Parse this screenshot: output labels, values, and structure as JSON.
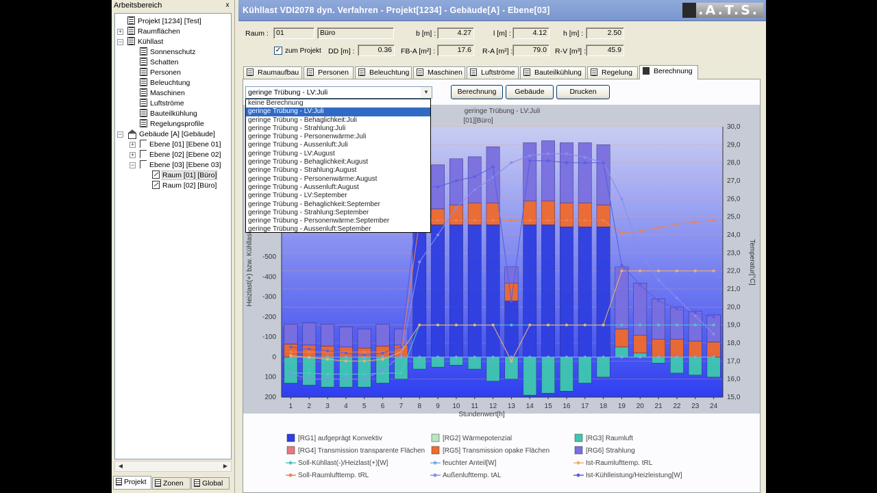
{
  "workspace": {
    "title": "Arbeitsbereich",
    "close": "x",
    "tree": [
      {
        "label": "Projekt [1234] [Test]",
        "level": 0,
        "icon": "document-icon",
        "exp": ""
      },
      {
        "label": "Raumflächen",
        "level": 0,
        "icon": "document-icon",
        "exp": "+"
      },
      {
        "label": "Kühllast",
        "level": 0,
        "icon": "document-icon",
        "exp": "-"
      },
      {
        "label": "Sonnenschutz",
        "level": 1,
        "icon": "document-icon",
        "exp": ""
      },
      {
        "label": "Schatten",
        "level": 1,
        "icon": "document-icon",
        "exp": ""
      },
      {
        "label": "Personen",
        "level": 1,
        "icon": "document-icon",
        "exp": ""
      },
      {
        "label": "Beleuchtung",
        "level": 1,
        "icon": "document-icon",
        "exp": ""
      },
      {
        "label": "Maschinen",
        "level": 1,
        "icon": "document-icon",
        "exp": ""
      },
      {
        "label": "Luftströme",
        "level": 1,
        "icon": "document-icon",
        "exp": ""
      },
      {
        "label": "Bauteilkühlung",
        "level": 1,
        "icon": "document-icon",
        "exp": ""
      },
      {
        "label": "Regelungsprofile",
        "level": 1,
        "icon": "document-icon",
        "exp": ""
      },
      {
        "label": "Gebäude [A] [Gebäude]",
        "level": 0,
        "icon": "building-icon",
        "exp": "-"
      },
      {
        "label": "Ebene [01] [Ebene 01]",
        "level": 1,
        "icon": "level-icon",
        "exp": "+"
      },
      {
        "label": "Ebene [02] [Ebene 02]",
        "level": 1,
        "icon": "level-icon",
        "exp": "+"
      },
      {
        "label": "Ebene [03] [Ebene 03]",
        "level": 1,
        "icon": "level-icon",
        "exp": "-"
      },
      {
        "label": "Raum [01] [Büro]",
        "level": 2,
        "icon": "room-icon",
        "exp": "",
        "selected": true
      },
      {
        "label": "Raum [02] [Büro]",
        "level": 2,
        "icon": "room-icon",
        "exp": ""
      }
    ],
    "tabs": [
      "Projekt",
      "Zonen",
      "Global"
    ]
  },
  "window": {
    "title": "Kühllast VDI2078 dyn. Verfahren - Projekt[1234] - Gebäude[A] - Ebene[03]",
    "logo": "C.A.T.S."
  },
  "room": {
    "raum_label": "Raum :",
    "raum_no": "01",
    "raum_name": "Büro",
    "b_label": "b [m] :",
    "b": "4.27",
    "l_label": "l [m] :",
    "l": "4.12",
    "h_label": "h [m] :",
    "h": "2.50",
    "zum_projekt": "zum Projekt",
    "zum_projekt_check": "✓",
    "dd_label": "DD [m] :",
    "dd": "0.36",
    "fba_label": "FB-A [m²] :",
    "fba": "17.6",
    "ra_label": "R-A [m²] :",
    "ra": "79.0",
    "rv_label": "R-V [m³] :",
    "rv": "45.9"
  },
  "tabs": [
    "Raumaufbau",
    "Personen",
    "Beleuchtung",
    "Maschinen",
    "Luftströme",
    "Bauteilkühlung",
    "Regelung",
    "Berechnung"
  ],
  "calc": {
    "selected": "geringe Trübung - LV:Juli",
    "buttons": [
      "Berechnung",
      "Gebäude",
      "Drucken"
    ],
    "options": [
      "keine Berechnung",
      "geringe Trübung - LV:Juli",
      "geringe Trübung - Behaglichkeit:Juli",
      "geringe Trübung - Strahlung:Juli",
      "geringe Trübung - Personenwärme:Juli",
      "geringe Trübung - Aussenluft:Juli",
      "geringe Trübung - LV:August",
      "geringe Trübung - Behaglichkeit:August",
      "geringe Trübung - Strahlung:August",
      "geringe Trübung - Personenwärme:August",
      "geringe Trübung - Aussenluft:August",
      "geringe Trübung - LV:September",
      "geringe Trübung - Behaglichkeit:September",
      "geringe Trübung - Strahlung:September",
      "geringe Trübung - Personenwärme:September",
      "geringe Trübung - Aussenluft:September"
    ],
    "selected_index": 1
  },
  "chart_data": {
    "type": "bar",
    "title": "geringe Trübung - LV:Juli",
    "subtitle": "[01][Büro]",
    "xlabel": "Stundenwert[h]",
    "ylabel": "Heizlast(+) bzw. Kühllast",
    "y2label": "Temperatur[°C]",
    "categories": [
      "1",
      "2",
      "3",
      "4",
      "5",
      "6",
      "7",
      "8",
      "9",
      "10",
      "11",
      "12",
      "13",
      "14",
      "15",
      "16",
      "17",
      "18",
      "19",
      "20",
      "21",
      "22",
      "23",
      "24"
    ],
    "ylim_inverted": [
      200,
      -1150
    ],
    "yticks": [
      200,
      100,
      0,
      -100,
      -200,
      -300,
      -400,
      -500
    ],
    "yticks_labels": [
      "200",
      "100",
      "0",
      "-100",
      "-200",
      "-300",
      "-400",
      "-500"
    ],
    "y2lim": [
      15.0,
      30.0
    ],
    "y2ticks": [
      "15,0",
      "16,0",
      "17,0",
      "18,0",
      "19,0",
      "20,0",
      "21,0",
      "22,0",
      "23,0",
      "24,0",
      "25,0",
      "26,0",
      "27,0",
      "28,0",
      "29,0",
      "30,0"
    ],
    "series": [
      {
        "name": "[RG1] aufgeprägt Konvektiv",
        "color": "#2f3fe0",
        "values": [
          0,
          0,
          0,
          0,
          0,
          0,
          0,
          -660,
          -660,
          -660,
          -660,
          -660,
          -280,
          -660,
          -660,
          -650,
          -650,
          -650,
          0,
          0,
          0,
          0,
          0,
          0
        ]
      },
      {
        "name": "[RG2] Wärmepotenzial",
        "color": "#b8e6c4",
        "values": [
          0,
          0,
          0,
          0,
          0,
          0,
          0,
          0,
          0,
          0,
          0,
          0,
          0,
          0,
          0,
          0,
          0,
          0,
          0,
          0,
          0,
          0,
          0,
          0
        ]
      },
      {
        "name": "[RG3] Raumluft",
        "color": "#3fc7b0",
        "values": [
          130,
          140,
          150,
          150,
          150,
          130,
          110,
          60,
          50,
          40,
          60,
          120,
          110,
          190,
          180,
          170,
          130,
          100,
          -50,
          -20,
          30,
          80,
          90,
          100
        ]
      },
      {
        "name": "[RG4] Transmission transparente Flächen",
        "color": "#e77880",
        "values": [
          0,
          0,
          0,
          0,
          0,
          0,
          0,
          0,
          0,
          0,
          0,
          0,
          0,
          0,
          0,
          0,
          0,
          0,
          0,
          0,
          0,
          0,
          0,
          0
        ]
      },
      {
        "name": "[RG5] Transmission opake Flächen",
        "color": "#ef6a2e",
        "values": [
          -65,
          -60,
          -55,
          -50,
          -45,
          -55,
          -60,
          -70,
          -80,
          -100,
          -110,
          -110,
          -90,
          -120,
          -120,
          -120,
          -120,
          -110,
          -90,
          -90,
          -90,
          -90,
          -80,
          -75
        ]
      },
      {
        "name": "[RG6] Strahlung",
        "color": "#7a6fe0",
        "values": [
          -100,
          -110,
          -110,
          -100,
          -95,
          -110,
          -80,
          -200,
          -220,
          -230,
          -230,
          -280,
          -80,
          -290,
          -300,
          -300,
          -300,
          -300,
          -310,
          -260,
          -200,
          -160,
          -150,
          -135
        ]
      }
    ],
    "lines": [
      {
        "name": "Soll-Kühllast(-)/Heizlast(+)[W]",
        "color": "#4fc6c6",
        "values": [
          80,
          80,
          85,
          85,
          85,
          80,
          80,
          -160,
          -160,
          -160,
          -160,
          -160,
          -160,
          -160,
          -160,
          -160,
          -160,
          -160,
          -160,
          -160,
          -160,
          -160,
          -160,
          -160
        ]
      },
      {
        "name": "feuchter Anteil[W]",
        "color": "#74b0e8",
        "values": [
          0,
          0,
          0,
          0,
          0,
          0,
          0,
          0,
          0,
          0,
          0,
          0,
          0,
          0,
          0,
          0,
          0,
          0,
          0,
          0,
          0,
          0,
          0,
          0
        ]
      },
      {
        "name": "Ist-Raumlufttemp. tRL",
        "color": "#f0b070",
        "values": [
          17.3,
          17.2,
          17.1,
          17.0,
          17.0,
          17.1,
          17.5,
          19.0,
          19.0,
          19.0,
          19.0,
          19.0,
          17.0,
          19.0,
          19.0,
          19.0,
          19.0,
          19.0,
          22.0,
          22.0,
          22.0,
          22.0,
          22.0,
          22.0
        ]
      },
      {
        "name": "Soll-Raumlufttemp. tRL",
        "color": "#f08050",
        "values": [
          17.5,
          17.5,
          17.5,
          17.5,
          17.5,
          17.5,
          17.5,
          24.8,
          24.8,
          24.8,
          24.8,
          24.8,
          24.8,
          24.8,
          24.8,
          24.8,
          24.8,
          24.8,
          24.1,
          24.2,
          24.4,
          24.6,
          24.7,
          24.8
        ]
      },
      {
        "name": "Außenlufttemp. tAL",
        "color": "#8a8cf0",
        "values": [
          16.3,
          16.0,
          16.0,
          16.0,
          16.0,
          16.5,
          17.3,
          22.5,
          24.0,
          25.5,
          26.5,
          27.2,
          28.0,
          28.4,
          28.5,
          28.5,
          28.3,
          28.0,
          26.0,
          23.0,
          21.5,
          20.5,
          19.5,
          18.5
        ]
      },
      {
        "name": "Ist-Kühlleistung/Heizleistung[W]",
        "color": "#5a5ee0",
        "values": [
          -50,
          -40,
          -30,
          -20,
          -10,
          -20,
          -50,
          -850,
          -850,
          -880,
          -900,
          -950,
          -280,
          -980,
          -980,
          -970,
          -970,
          -970,
          -460,
          -360,
          -280,
          -240,
          -220,
          -200
        ]
      }
    ],
    "legend": [
      "[RG1] aufgeprägt Konvektiv",
      "[RG2] Wärmepotenzial",
      "[RG3] Raumluft",
      "[RG4] Transmission transparente Flächen",
      "[RG5] Transmission opake Flächen",
      "[RG6] Strahlung",
      "Soll-Kühllast(-)/Heizlast(+)[W]",
      "feuchter Anteil[W]",
      "Ist-Raumlufttemp. tRL",
      "Soll-Raumlufttemp. tRL",
      "Außenlufttemp. tAL",
      "Ist-Kühlleistung/Heizleistung[W]"
    ]
  }
}
